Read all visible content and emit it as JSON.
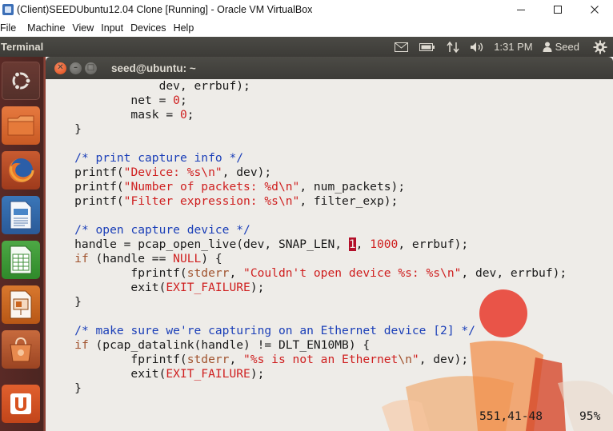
{
  "host_window": {
    "title": "(Client)SEEDUbuntu12.04 Clone [Running] - Oracle VM VirtualBox",
    "controls": [
      "minimize-icon",
      "maximize-icon",
      "close-icon"
    ]
  },
  "vbox_menu": [
    "File",
    "Machine",
    "View",
    "Input",
    "Devices",
    "Help"
  ],
  "ubuntu_panel": {
    "app_title": "Terminal",
    "indicators": [
      "mail-icon",
      "battery-icon",
      "network-icon",
      "volume-icon"
    ],
    "clock": "1:31 PM",
    "user": "Seed",
    "settings_icon": "gear-icon"
  },
  "launcher": {
    "items": [
      "dash-home-icon",
      "files-icon",
      "firefox-icon",
      "libreoffice-writer-icon",
      "libreoffice-calc-icon",
      "libreoffice-impress-icon",
      "software-center-icon",
      "ubuntu-one-icon"
    ]
  },
  "terminal": {
    "title": "seed@ubuntu: ~",
    "colors": {
      "keyword": "#a0522d",
      "comment": "#1b3fb8",
      "string": "#cf1f1f",
      "cursor": "#b3102a"
    },
    "code_lines": [
      [
        {
          "t": "                dev, errbuf);"
        }
      ],
      [
        {
          "t": "            net = "
        },
        {
          "t": "0",
          "c": "num"
        },
        {
          "t": ";"
        }
      ],
      [
        {
          "t": "            mask = "
        },
        {
          "t": "0",
          "c": "num"
        },
        {
          "t": ";"
        }
      ],
      [
        {
          "t": "    }"
        }
      ],
      [
        {
          "t": ""
        }
      ],
      [
        {
          "t": "    "
        },
        {
          "t": "/* print capture info */",
          "c": "cm"
        }
      ],
      [
        {
          "t": "    printf("
        },
        {
          "t": "\"Device: %s\\n\"",
          "c": "str"
        },
        {
          "t": ", dev);"
        }
      ],
      [
        {
          "t": "    printf("
        },
        {
          "t": "\"Number of packets: %d\\n\"",
          "c": "str"
        },
        {
          "t": ", num_packets);"
        }
      ],
      [
        {
          "t": "    printf("
        },
        {
          "t": "\"Filter expression: %s\\n\"",
          "c": "str"
        },
        {
          "t": ", filter_exp);"
        }
      ],
      [
        {
          "t": ""
        }
      ],
      [
        {
          "t": "    "
        },
        {
          "t": "/* open capture device */",
          "c": "cm"
        }
      ],
      [
        {
          "t": "    handle = pcap_open_live(dev, SNAP_LEN, "
        },
        {
          "t": "1",
          "c": "cursor"
        },
        {
          "t": ", "
        },
        {
          "t": "1000",
          "c": "num"
        },
        {
          "t": ", errbuf);"
        }
      ],
      [
        {
          "t": "    "
        },
        {
          "t": "if",
          "c": "kw"
        },
        {
          "t": " (handle == "
        },
        {
          "t": "NULL",
          "c": "str"
        },
        {
          "t": ") {"
        }
      ],
      [
        {
          "t": "            fprintf("
        },
        {
          "t": "stderr",
          "c": "kw"
        },
        {
          "t": ", "
        },
        {
          "t": "\"Couldn't open device %s: %s\\n\"",
          "c": "str"
        },
        {
          "t": ", dev, errbuf);"
        }
      ],
      [
        {
          "t": "            exit("
        },
        {
          "t": "EXIT_FAILURE",
          "c": "str"
        },
        {
          "t": ");"
        }
      ],
      [
        {
          "t": "    }"
        }
      ],
      [
        {
          "t": ""
        }
      ],
      [
        {
          "t": "    "
        },
        {
          "t": "/* make sure we're capturing on an Ethernet device [2] */",
          "c": "cm"
        }
      ],
      [
        {
          "t": "    "
        },
        {
          "t": "if",
          "c": "kw"
        },
        {
          "t": " (pcap_datalink(handle) != DLT_EN10MB) {"
        }
      ],
      [
        {
          "t": "            fprintf("
        },
        {
          "t": "stderr",
          "c": "kw"
        },
        {
          "t": ", "
        },
        {
          "t": "\"%s is not an Ethernet",
          "c": "str"
        },
        {
          "t": "\\n",
          "c": "kw"
        },
        {
          "t": "\"",
          "c": "str"
        },
        {
          "t": ", dev);"
        }
      ],
      [
        {
          "t": "            exit("
        },
        {
          "t": "EXIT_FAILURE",
          "c": "str"
        },
        {
          "t": ");"
        }
      ],
      [
        {
          "t": "    }"
        }
      ]
    ],
    "status_position": "551,41-48",
    "status_percent": "95%"
  }
}
